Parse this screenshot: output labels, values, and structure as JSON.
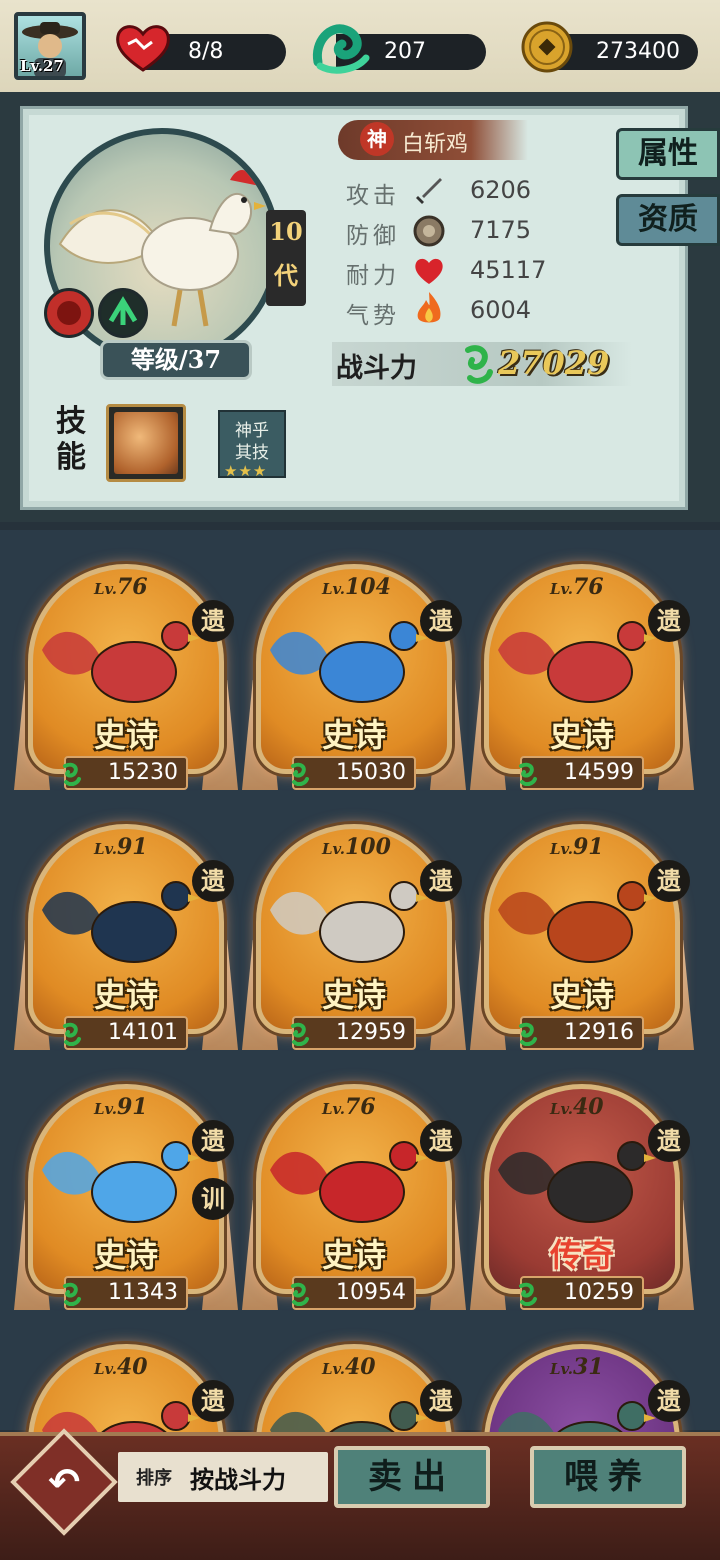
{
  "player": {
    "level": "Lv.27"
  },
  "resources": {
    "stamina": "8/8",
    "jade": "207",
    "coins": "273400"
  },
  "detail": {
    "generation": "10代",
    "level_label": "等级/37",
    "quality_badge": "神",
    "name": "白斩鸡",
    "stats": [
      {
        "label": "攻击",
        "icon": "sword-icon",
        "value": "6206"
      },
      {
        "label": "防御",
        "icon": "shield-icon",
        "value": "7175"
      },
      {
        "label": "耐力",
        "icon": "heart-icon",
        "value": "45117"
      },
      {
        "label": "气势",
        "icon": "fire-icon",
        "value": "6004"
      }
    ],
    "power_label": "战斗力",
    "power_value": "27029",
    "tabs": {
      "attributes": "属性",
      "aptitude": "资质"
    },
    "skill_label": "技能",
    "skill_card": {
      "line1": "神乎",
      "line2": "其技"
    }
  },
  "cards": [
    {
      "lv": "76",
      "rarity": "史诗",
      "power": "15230",
      "tags": [
        "遗"
      ],
      "theme": "epic",
      "bird_color": "#c83a3a"
    },
    {
      "lv": "104",
      "rarity": "史诗",
      "power": "15030",
      "tags": [
        "遗"
      ],
      "theme": "epic",
      "bird_color": "#3b86d6"
    },
    {
      "lv": "76",
      "rarity": "史诗",
      "power": "14599",
      "tags": [
        "遗"
      ],
      "theme": "epic",
      "bird_color": "#c83a3a"
    },
    {
      "lv": "91",
      "rarity": "史诗",
      "power": "14101",
      "tags": [
        "遗"
      ],
      "theme": "epic",
      "bird_color": "#1f3550"
    },
    {
      "lv": "100",
      "rarity": "史诗",
      "power": "12959",
      "tags": [
        "遗"
      ],
      "theme": "epic",
      "bird_color": "#cfcac2"
    },
    {
      "lv": "91",
      "rarity": "史诗",
      "power": "12916",
      "tags": [
        "遗"
      ],
      "theme": "epic",
      "bird_color": "#b8451c"
    },
    {
      "lv": "91",
      "rarity": "史诗",
      "power": "11343",
      "tags": [
        "遗",
        "训"
      ],
      "theme": "epic",
      "bird_color": "#4fa6e8"
    },
    {
      "lv": "76",
      "rarity": "史诗",
      "power": "10954",
      "tags": [
        "遗"
      ],
      "theme": "epic",
      "bird_color": "#c7262a"
    },
    {
      "lv": "40",
      "rarity": "传奇",
      "power": "10259",
      "tags": [
        "遗"
      ],
      "theme": "legend",
      "bird_color": "#2c2a2a"
    },
    {
      "lv": "40",
      "rarity": "",
      "power": "",
      "tags": [
        "遗"
      ],
      "theme": "epic",
      "bird_color": "#c83a3a"
    },
    {
      "lv": "40",
      "rarity": "",
      "power": "",
      "tags": [
        "遗"
      ],
      "theme": "epic",
      "bird_color": "#415b4f"
    },
    {
      "lv": "31",
      "rarity": "",
      "power": "",
      "tags": [
        "遗"
      ],
      "theme": "mythic",
      "bird_color": "#3f6e64"
    }
  ],
  "bottom": {
    "sort_label": "排序",
    "sort_value": "按战斗力",
    "sell": "卖出",
    "feed": "喂养"
  },
  "colors": {
    "epic_frame": "#e08b24",
    "legend_frame": "#9a3b33",
    "mythic_frame": "#6a327f",
    "power_gold": "#e9c85a"
  }
}
